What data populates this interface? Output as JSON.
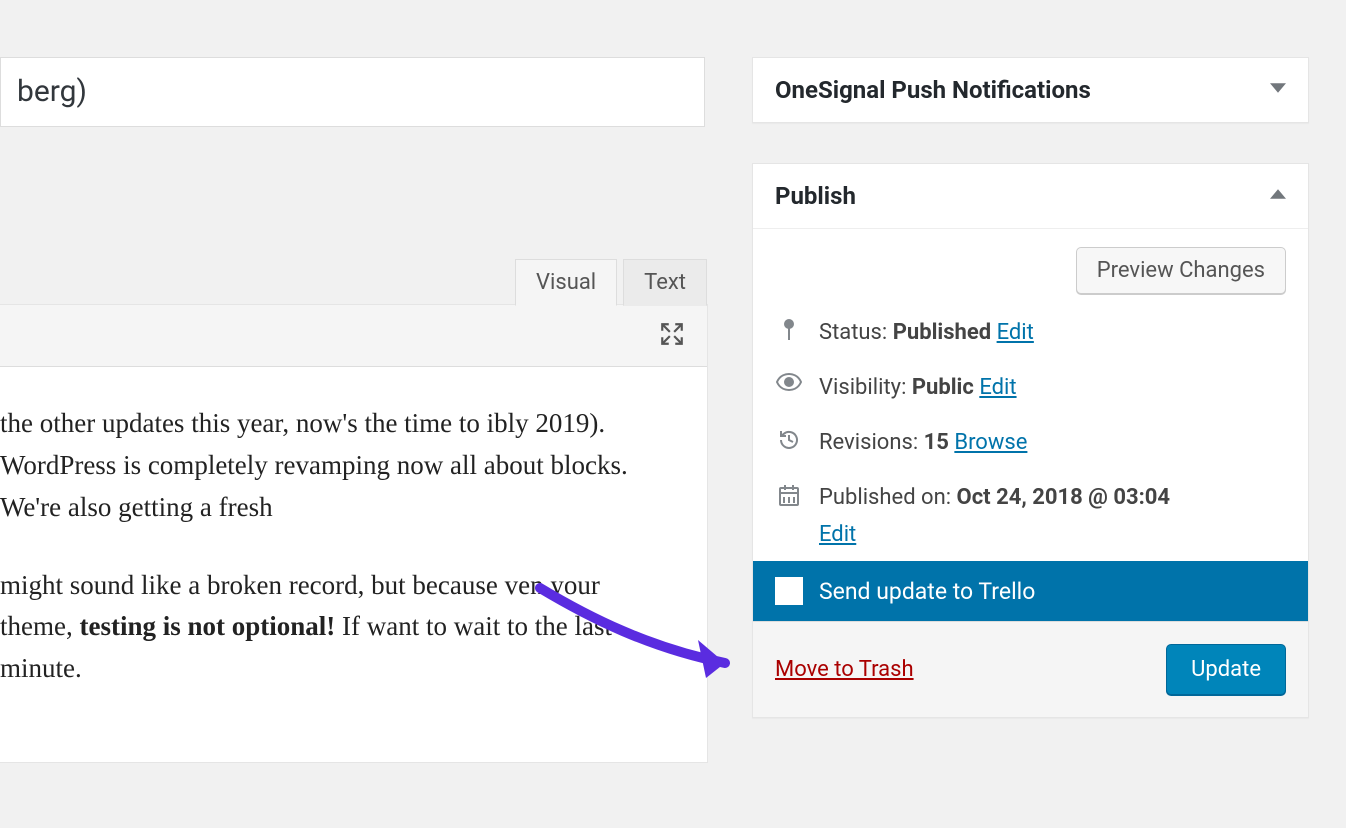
{
  "title_value": "berg)",
  "editor": {
    "tab_visual": "Visual",
    "tab_text": "Text",
    "paragraph1": " the other updates this year, now's the time to ibly 2019). WordPress is completely revamping now all about blocks. We're also getting a fresh",
    "paragraph2_pre": "might sound like a broken record, but because ven your theme, ",
    "paragraph2_bold": "testing is not optional!",
    "paragraph2_post": " If want to wait to the last minute."
  },
  "sidebar": {
    "onesignal_title": "OneSignal Push Notifications",
    "publish": {
      "title": "Publish",
      "preview_label": "Preview Changes",
      "status_label": "Status: ",
      "status_value": "Published",
      "status_edit": "Edit",
      "visibility_label": "Visibility: ",
      "visibility_value": "Public",
      "visibility_edit": "Edit",
      "revisions_label": "Revisions: ",
      "revisions_value": "15",
      "revisions_browse": "Browse",
      "published_label": "Published on: ",
      "published_value": "Oct 24, 2018 @ 03:04",
      "published_edit": "Edit",
      "trello_label": "Send update to Trello",
      "trash_label": "Move to Trash",
      "update_label": "Update"
    }
  }
}
